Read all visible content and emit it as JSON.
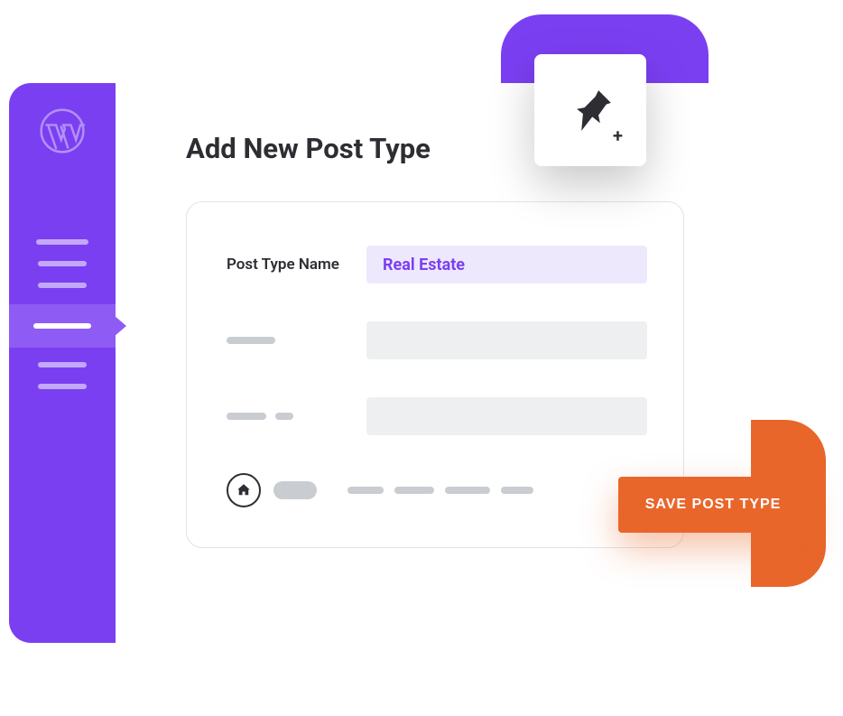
{
  "page_title": "Add New Post Type",
  "form": {
    "post_type_name_label": "Post Type Name",
    "post_type_name_value": "Real Estate"
  },
  "save_button_label": "SAVE POST TYPE",
  "colors": {
    "accent_purple": "#7B3FF2",
    "accent_orange": "#E9662B"
  }
}
